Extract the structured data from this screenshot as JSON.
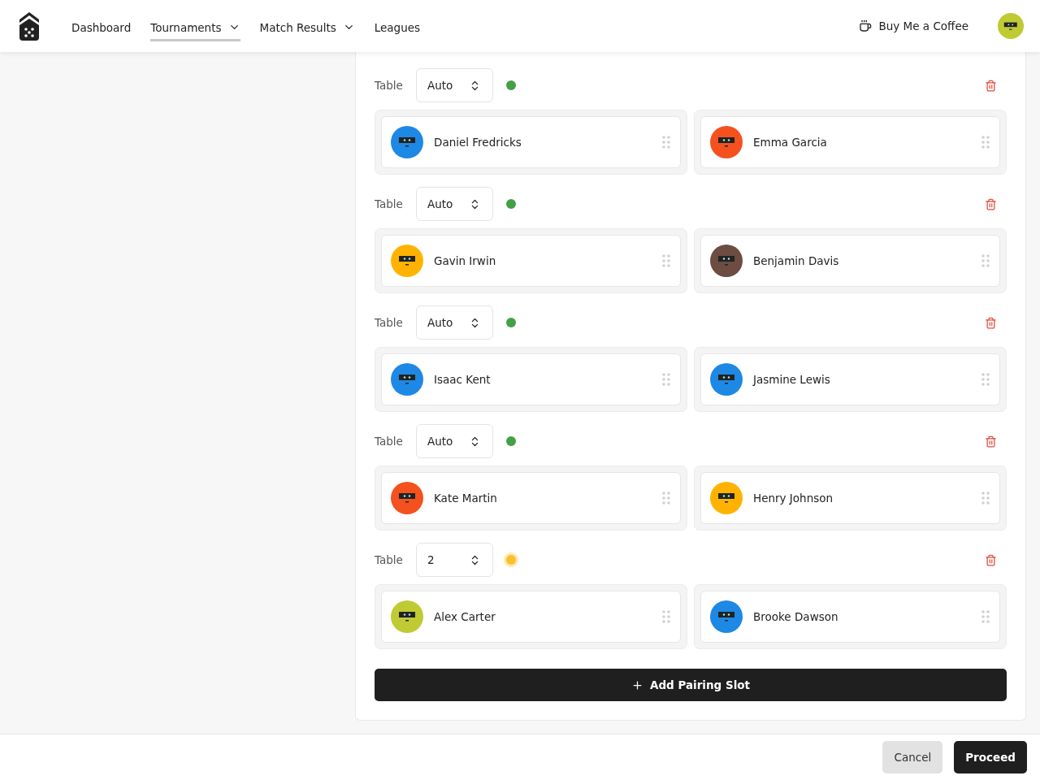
{
  "nav": {
    "items": [
      {
        "label": "Dashboard",
        "dropdown": false,
        "selected": false
      },
      {
        "label": "Tournaments",
        "dropdown": true,
        "selected": true
      },
      {
        "label": "Match Results",
        "dropdown": true,
        "selected": false
      },
      {
        "label": "Leagues",
        "dropdown": false,
        "selected": false
      }
    ],
    "coffee": "Buy Me a Coffee"
  },
  "slots": [
    {
      "label": "Table",
      "value": "Auto",
      "color": "#43a047",
      "players": [
        {
          "name": "Daniel Fredricks",
          "color": "#1e88e5"
        },
        {
          "name": "Emma Garcia",
          "color": "#f4511e"
        }
      ]
    },
    {
      "label": "Table",
      "value": "Auto",
      "color": "#43a047",
      "players": [
        {
          "name": "Gavin Irwin",
          "color": "#ffb300"
        },
        {
          "name": "Benjamin Davis",
          "color": "#6d4c41"
        }
      ]
    },
    {
      "label": "Table",
      "value": "Auto",
      "color": "#43a047",
      "players": [
        {
          "name": "Isaac Kent",
          "color": "#1e88e5"
        },
        {
          "name": "Jasmine Lewis",
          "color": "#1e88e5"
        }
      ]
    },
    {
      "label": "Table",
      "value": "Auto",
      "color": "#43a047",
      "players": [
        {
          "name": "Kate Martin",
          "color": "#f4511e"
        },
        {
          "name": "Henry Johnson",
          "color": "#ffb300"
        }
      ]
    },
    {
      "label": "Table",
      "value": "2",
      "color": "#fbc02d",
      "players": [
        {
          "name": "Alex Carter",
          "color": "#c0ca33"
        },
        {
          "name": "Brooke Dawson",
          "color": "#1e88e5"
        }
      ]
    }
  ],
  "add_button": "Add Pairing Slot",
  "footer": {
    "cancel": "Cancel",
    "proceed": "Proceed"
  }
}
